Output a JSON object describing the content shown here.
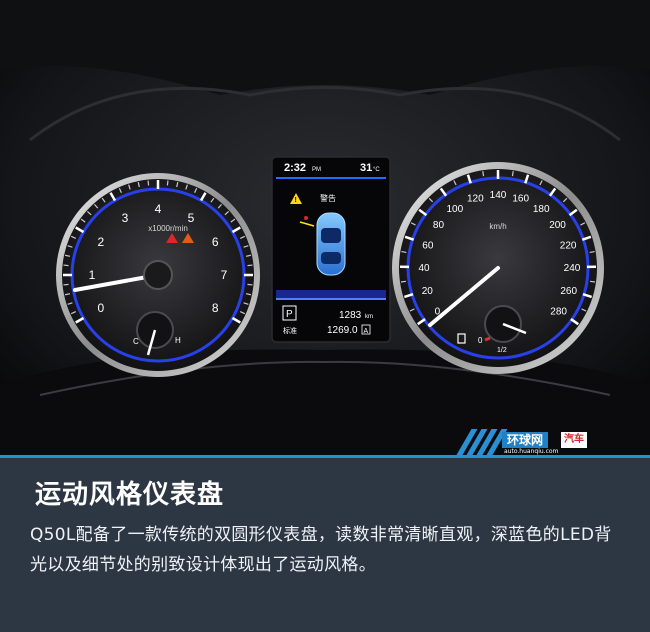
{
  "cluster": {
    "tach_labels": [
      "0",
      "1",
      "2",
      "3",
      "4",
      "5",
      "6",
      "7",
      "8"
    ],
    "tach_unit": "x1000r/min",
    "temp_cold": "C",
    "temp_hot": "H",
    "speed_labels": [
      "0",
      "20",
      "40",
      "60",
      "80",
      "100",
      "120",
      "140",
      "160",
      "180",
      "200",
      "220",
      "240",
      "260",
      "280"
    ],
    "speed_unit": "km/h",
    "fuel_empty": "0",
    "fuel_half": "1/2",
    "display": {
      "time": "2:32",
      "ampm": "PM",
      "temp": "31",
      "temp_unit": "°C",
      "warning": "警告",
      "gear": "P",
      "odometer": "1283",
      "odometer_unit": "km",
      "trip_label": "标准",
      "trip": "1269.0",
      "trip_tag": "A"
    },
    "colors": {
      "backlight": "#2a45ff",
      "needle": "#ffffff",
      "warning": "#ffd21e"
    }
  },
  "watermark": {
    "logo_text": "环球网",
    "logo_tag": "汽车",
    "url": "auto.huanqiu.com"
  },
  "caption": {
    "title": "运动风格仪表盘",
    "body": "Q50L配备了一款传统的双圆形仪表盘，读数非常清晰直观，深蓝色的LED背光以及细节处的别致设计体现出了运动风格。"
  }
}
